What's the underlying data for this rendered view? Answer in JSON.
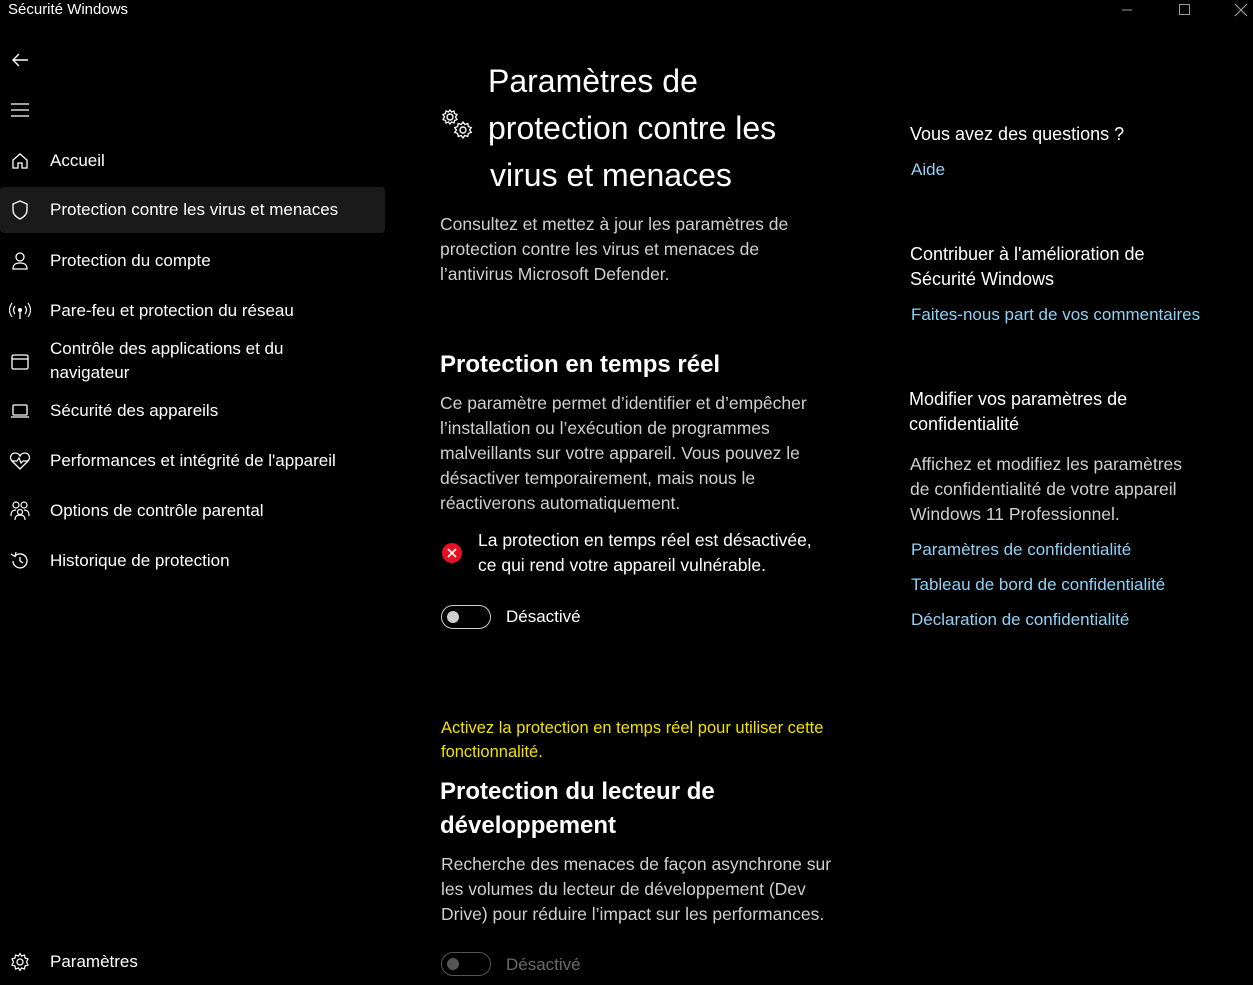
{
  "window": {
    "title": "Sécurité Windows"
  },
  "sidebar": {
    "items": [
      {
        "label": "Accueil",
        "icon": "home-icon"
      },
      {
        "label": "Protection contre les virus et menaces",
        "icon": "shield-icon",
        "selected": true
      },
      {
        "label": "Protection du compte",
        "icon": "person-icon"
      },
      {
        "label": "Pare-feu et protection du réseau",
        "icon": "wifi-antenna-icon"
      },
      {
        "label_line1": "Contrôle des applications et du",
        "label_line2": "navigateur",
        "icon": "app-browser-icon"
      },
      {
        "label": "Sécurité des appareils",
        "icon": "laptop-icon"
      },
      {
        "label": "Performances et intégrité de l'appareil",
        "icon": "heart-pulse-icon"
      },
      {
        "label": "Options de contrôle parental",
        "icon": "family-icon"
      },
      {
        "label": "Historique de protection",
        "icon": "history-icon"
      }
    ],
    "settings_label": "Paramètres"
  },
  "main": {
    "title_lines": [
      "Paramètres de",
      "protection contre les",
      "virus et menaces"
    ],
    "intro_lines": [
      "Consultez et mettez à jour les paramètres de",
      "protection contre les virus et menaces de",
      "l’antivirus Microsoft Defender."
    ],
    "realtime": {
      "title": "Protection en temps réel",
      "desc_lines": [
        "Ce paramètre permet d’identifier et d’empêcher",
        "l’installation ou l’exécution de programmes",
        "malveillants sur votre appareil. Vous pouvez le",
        "désactiver temporairement, mais nous le",
        "réactiverons automatiquement."
      ],
      "alert_lines": [
        "La protection en temps réel est désactivée,",
        "ce qui rend votre appareil vulnérable."
      ],
      "toggle_label": "Désactivé",
      "toggle_on": false
    },
    "devdrive": {
      "warning_lines": [
        "Activez la protection en temps réel pour utiliser cette",
        "fonctionnalité."
      ],
      "title_lines": [
        "Protection du lecteur de",
        "développement"
      ],
      "desc_lines": [
        "Recherche des menaces de façon asynchrone sur",
        "les volumes du lecteur de développement (Dev",
        "Drive) pour réduire l’impact sur les performances."
      ],
      "toggle_label": "Désactivé",
      "toggle_on": false
    }
  },
  "aside": {
    "questions_title": "Vous avez des questions ?",
    "help_link": "Aide",
    "improve_title_lines": [
      "Contribuer à l'amélioration de",
      "Sécurité Windows"
    ],
    "feedback_link": "Faites-nous part de vos commentaires",
    "privacy_title_lines": [
      "Modifier vos paramètres de",
      "confidentialité"
    ],
    "privacy_desc_lines": [
      "Affichez et modifiez les paramètres",
      "de confidentialité de votre appareil",
      "Windows 11 Professionnel."
    ],
    "privacy_links": [
      "Paramètres de confidentialité",
      "Tableau de bord de confidentialité",
      "Déclaration de confidentialité"
    ]
  },
  "colors": {
    "background": "#000000",
    "link": "#8fd1f5",
    "warning": "#f2e000",
    "error": "#e81123"
  }
}
